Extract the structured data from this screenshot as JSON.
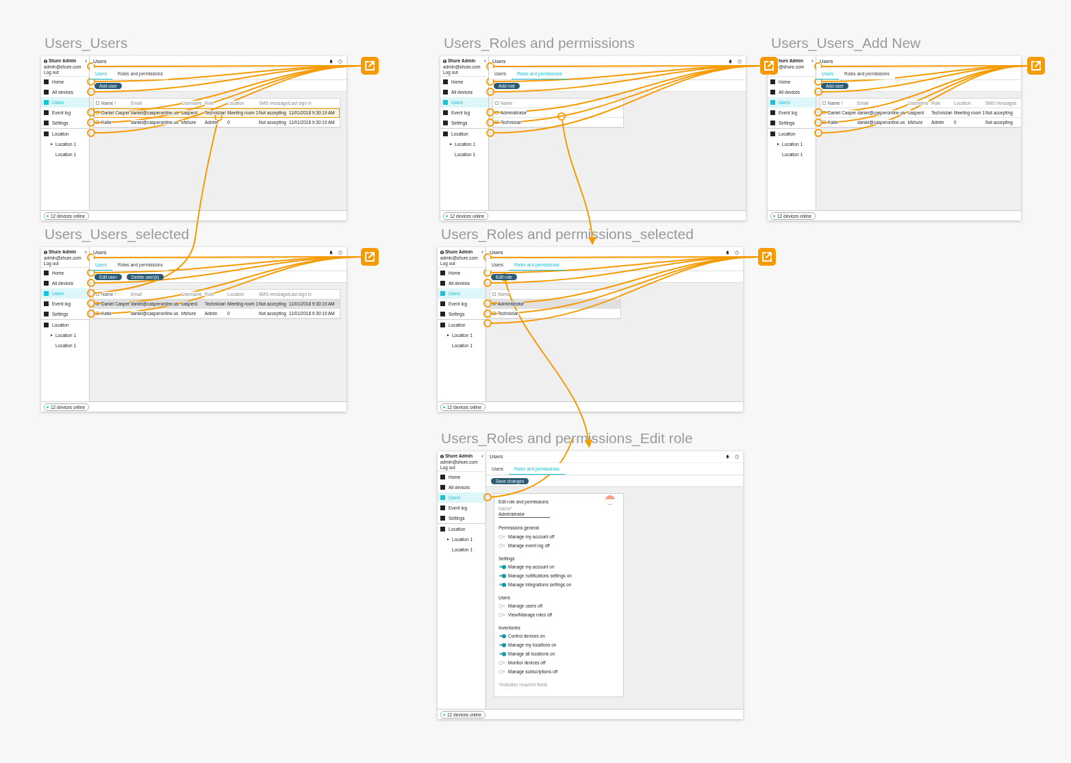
{
  "screens": [
    {
      "title": "Users_Users",
      "sidebar": {
        "user": "Shure Admin",
        "email": "admin@shure.com",
        "logout": "Log out",
        "items": [
          {
            "label": "Home",
            "selected": false
          },
          {
            "label": "All devices",
            "selected": false
          },
          {
            "label": "Users",
            "selected": true
          },
          {
            "label": "Event log",
            "selected": false
          },
          {
            "label": "Settings",
            "selected": false
          }
        ],
        "location": {
          "label": "Location",
          "children": [
            {
              "label": "Location 1",
              "expandable": true
            },
            {
              "label": "Location 1",
              "expandable": false
            }
          ]
        }
      },
      "header": {
        "title": "Users",
        "icons": true
      },
      "tabs": [
        {
          "label": "Users",
          "selected": true
        },
        {
          "label": "Roles and permissions",
          "selected": false
        }
      ],
      "buttons": [
        "Add user"
      ],
      "table": {
        "kind": "users",
        "all_selected": false,
        "columns": [
          {
            "label": "Name",
            "sorted": true
          },
          {
            "label": "Email",
            "sorted": false
          },
          {
            "label": "Username",
            "sorted": false
          },
          {
            "label": "Role",
            "sorted": false
          },
          {
            "label": "Location",
            "sorted": false
          },
          {
            "label": "SMS messages",
            "sorted": false
          },
          {
            "label": "Last sign in",
            "sorted": false
          }
        ],
        "rows": [
          {
            "cells": [
              "Daniel Casper",
              "daniel@casperonline.us",
              "casperd",
              "Technician",
              "Meeting room 1",
              "Not accepting",
              "11/01/2018 9:30:19 AM"
            ],
            "selected": false,
            "hotspot": true
          },
          {
            "cells": [
              "Katie",
              "daniel@casperonline.us",
              "kfshure",
              "Admin",
              "0",
              "Not accepting",
              "11/01/2018 9:30:19 AM"
            ],
            "selected": false,
            "hotspot": false
          }
        ]
      },
      "status": "12 devices online"
    },
    {
      "title": "Users_Roles and permissions",
      "sidebar": {
        "user": "Shure Admin",
        "email": "admin@shure.com",
        "logout": "Log out",
        "items": [
          {
            "label": "Home",
            "selected": false
          },
          {
            "label": "All devices",
            "selected": false
          },
          {
            "label": "Users",
            "selected": true
          },
          {
            "label": "Event log",
            "selected": false
          },
          {
            "label": "Settings",
            "selected": false
          }
        ],
        "location": {
          "label": "Location",
          "children": [
            {
              "label": "Location 1",
              "expandable": true
            },
            {
              "label": "Location 1",
              "expandable": false
            }
          ]
        }
      },
      "header": {
        "title": "Users",
        "icons": true
      },
      "tabs": [
        {
          "label": "Users",
          "selected": false
        },
        {
          "label": "Roles and permissions",
          "selected": true
        }
      ],
      "buttons": [
        "Add role"
      ],
      "table": {
        "kind": "roles",
        "all_selected": false,
        "columns": [
          {
            "label": "Name",
            "sorted": false
          }
        ],
        "rows": [
          {
            "cells": [
              "Administrator"
            ],
            "selected": false,
            "hotspot": false
          },
          {
            "cells": [
              "Technician"
            ],
            "selected": false,
            "hotspot": false
          }
        ]
      },
      "status": "12 devices online"
    },
    {
      "title": "Users_Users_Add New",
      "sidebar": {
        "user": "hure Admin",
        "email": "@shure.com",
        "items": [
          {
            "label": "Home",
            "selected": false
          },
          {
            "label": "All devices",
            "selected": false
          },
          {
            "label": "Users",
            "selected": true
          },
          {
            "label": "Event log",
            "selected": false
          },
          {
            "label": "Settings",
            "selected": false
          }
        ],
        "location": {
          "label": "Location",
          "children": [
            {
              "label": "Location 1",
              "expandable": true
            },
            {
              "label": "Location 1",
              "expandable": false
            }
          ]
        }
      },
      "header": {
        "title": "Users",
        "icons": false
      },
      "tabs": [
        {
          "label": "Users",
          "selected": true
        },
        {
          "label": "Roles and permissions",
          "selected": false
        }
      ],
      "buttons": [
        "Add user"
      ],
      "table": {
        "kind": "users",
        "all_selected": false,
        "columns": [
          {
            "label": "Name",
            "sorted": true
          },
          {
            "label": "Email",
            "sorted": false
          },
          {
            "label": "Username",
            "sorted": false
          },
          {
            "label": "Role",
            "sorted": false
          },
          {
            "label": "Location",
            "sorted": false
          },
          {
            "label": "SMS messages",
            "sorted": false
          }
        ],
        "rows": [
          {
            "cells": [
              "Daniel Casper",
              "daniel@casperonline.us",
              "casperd",
              "Technician",
              "Meeting room 1",
              "Not accepting"
            ],
            "selected": false,
            "hotspot": false
          },
          {
            "cells": [
              "Katie",
              "daniel@casperonline.us",
              "kfshure",
              "Admin",
              "0",
              "Not accepting"
            ],
            "selected": false,
            "hotspot": false
          }
        ]
      },
      "status": "12 devices online"
    },
    {
      "title": "Users_Users_selected",
      "sidebar": {
        "user": "Shure Admin",
        "email": "admin@shure.com",
        "logout": "Log out",
        "items": [
          {
            "label": "Home",
            "selected": false
          },
          {
            "label": "All devices",
            "selected": false
          },
          {
            "label": "Users",
            "selected": true
          },
          {
            "label": "Event log",
            "selected": false
          },
          {
            "label": "Settings",
            "selected": false
          }
        ],
        "location": {
          "label": "Location",
          "children": [
            {
              "label": "Location 1",
              "expandable": true
            },
            {
              "label": "Location 1",
              "expandable": false
            }
          ]
        }
      },
      "header": {
        "title": "Users",
        "icons": true
      },
      "tabs": [
        {
          "label": "Users",
          "selected": true
        },
        {
          "label": "Roles and permissions",
          "selected": false
        }
      ],
      "buttons": [
        "Edit user",
        "Delete user(s)"
      ],
      "table": {
        "kind": "users",
        "all_selected": false,
        "columns": [
          {
            "label": "Name",
            "sorted": true
          },
          {
            "label": "Email",
            "sorted": false
          },
          {
            "label": "Username",
            "sorted": false
          },
          {
            "label": "Role",
            "sorted": false
          },
          {
            "label": "Location",
            "sorted": false
          },
          {
            "label": "SMS messages",
            "sorted": false
          },
          {
            "label": "Last sign in",
            "sorted": false
          }
        ],
        "rows": [
          {
            "cells": [
              "Daniel Casper",
              "daniel@casperonline.us",
              "casperd",
              "Technician",
              "Meeting room 1",
              "Not accepting",
              "11/01/2018 9:30:19 AM"
            ],
            "selected": true,
            "hotspot": false
          },
          {
            "cells": [
              "Katie",
              "daniel@casperonline.us",
              "kfshure",
              "Admin",
              "0",
              "Not accepting",
              "11/01/2018 9:30:19 AM"
            ],
            "selected": false,
            "hotspot": false
          }
        ]
      },
      "status": "12 devices online"
    },
    {
      "title": "Users_Roles and permissions_selected",
      "sidebar": {
        "user": "Shure Admin",
        "email": "admin@shure.com",
        "logout": "Log out",
        "items": [
          {
            "label": "Home",
            "selected": false
          },
          {
            "label": "All devices",
            "selected": false
          },
          {
            "label": "Users",
            "selected": true
          },
          {
            "label": "Event log",
            "selected": false
          },
          {
            "label": "Settings",
            "selected": false
          }
        ],
        "location": {
          "label": "Location",
          "children": [
            {
              "label": "Location 1",
              "expandable": true
            },
            {
              "label": "Location 1",
              "expandable": false
            }
          ]
        }
      },
      "header": {
        "title": "Users",
        "icons": true
      },
      "tabs": [
        {
          "label": "Users",
          "selected": false
        },
        {
          "label": "Roles and permissions",
          "selected": true
        }
      ],
      "buttons": [
        "Edit role"
      ],
      "table": {
        "kind": "roles",
        "all_selected": false,
        "columns": [
          {
            "label": "Name",
            "sorted": false
          }
        ],
        "rows": [
          {
            "cells": [
              "Administrator"
            ],
            "selected": true,
            "hotspot": false
          },
          {
            "cells": [
              "Technician"
            ],
            "selected": false,
            "hotspot": false
          }
        ]
      },
      "status": "12 devices online"
    },
    {
      "title": "Users_Roles and permissions_Edit role",
      "sidebar": {
        "user": "Shure Admin",
        "email": "admin@shure.com",
        "logout": "Log out",
        "items": [
          {
            "label": "Home",
            "selected": false
          },
          {
            "label": "All devices",
            "selected": false
          },
          {
            "label": "Users",
            "selected": true
          },
          {
            "label": "Event log",
            "selected": false
          },
          {
            "label": "Settings",
            "selected": false
          }
        ],
        "location": {
          "label": "Location",
          "children": [
            {
              "label": "Location 1",
              "expandable": true
            },
            {
              "label": "Location 1",
              "expandable": false
            }
          ]
        }
      },
      "header": {
        "title": "Users",
        "icons": true
      },
      "tabs": [
        {
          "label": "Users",
          "selected": false
        },
        {
          "label": "Roles and permissions",
          "selected": true
        }
      ],
      "buttons": [
        "Save changes"
      ],
      "form": {
        "title": "Edit role and permissions",
        "name_label": "Name*",
        "name_value": "Administrator",
        "sections": [
          {
            "title": "Permissions general",
            "toggles": [
              {
                "label": "Manage my account off",
                "on": false
              },
              {
                "label": "Manage event log off",
                "on": false
              }
            ]
          },
          {
            "title": "Settings",
            "toggles": [
              {
                "label": "Manage my account on",
                "on": true
              },
              {
                "label": "Manage notifications settings on",
                "on": true
              },
              {
                "label": "Manage integrations settings on",
                "on": true
              }
            ]
          },
          {
            "title": "Users",
            "toggles": [
              {
                "label": "Manage users off",
                "on": false
              },
              {
                "label": "View/Manage roles off",
                "on": false
              }
            ]
          },
          {
            "title": "Inventories",
            "toggles": [
              {
                "label": "Control devices on",
                "on": true
              },
              {
                "label": "Manage my locations on",
                "on": true
              },
              {
                "label": "Manage all locations on",
                "on": true
              },
              {
                "label": "Monitor devices off",
                "on": false
              },
              {
                "label": "Manage subscriptions off",
                "on": false
              }
            ]
          }
        ],
        "note": "*Indicates required fields"
      },
      "status": "12 devices online"
    }
  ]
}
